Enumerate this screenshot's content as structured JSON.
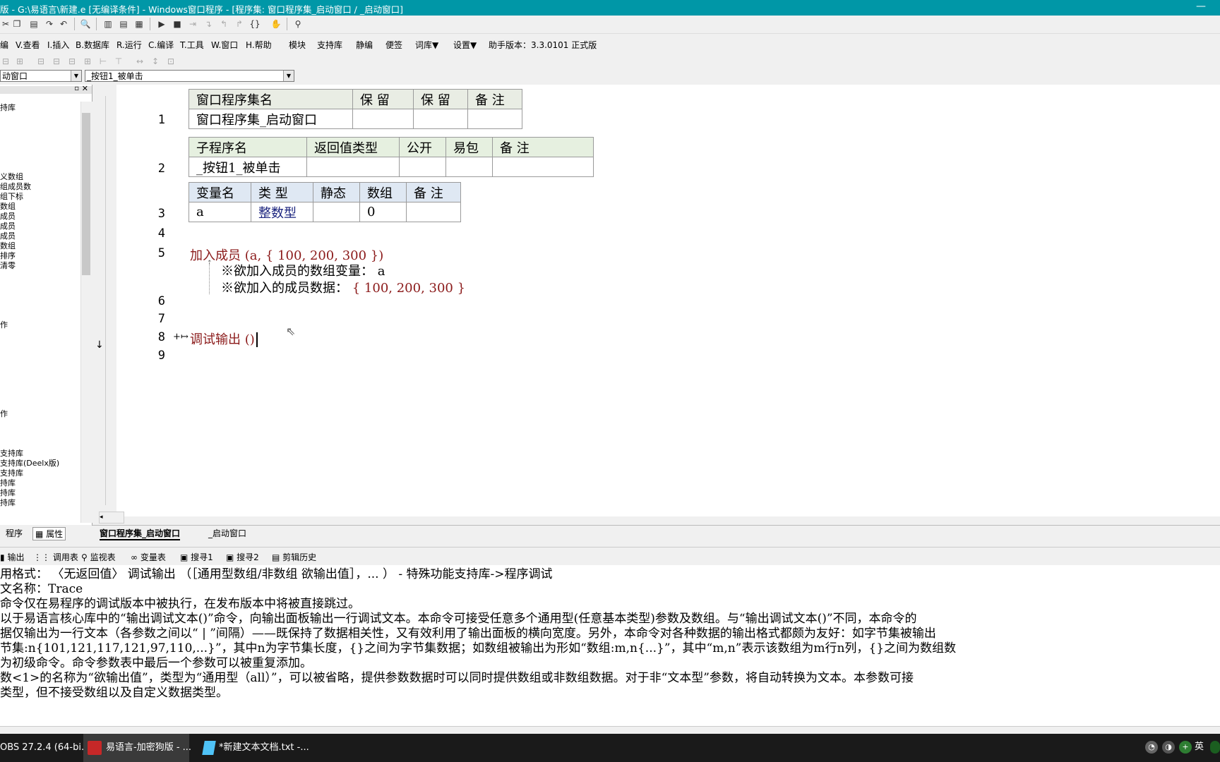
{
  "title": "版 - G:\\易语言\\新建.e [无编译条件] - Windows窗口程序 - [程序集: 窗口程序集_启动窗口 / _启动窗口]",
  "menu": [
    "编",
    "V.查看",
    "I.插入",
    "B.数据库",
    "R.运行",
    "C.编译",
    "T.工具",
    "W.窗口",
    "H.帮助",
    "模块",
    "支持库",
    "静编",
    "便签",
    "词库▼",
    "设置▼"
  ],
  "helper_version": "助手版本：3.3.0101 正式版",
  "combo_left": "动窗口",
  "combo_right": "_按钮1_被单击",
  "tree_items": [
    "持库",
    "义数组",
    "组成员数",
    "组下标",
    "数组",
    "成员",
    "成员",
    "成员",
    "数组",
    "排序",
    "清零",
    "作",
    "作",
    "支持库",
    "支持库(Deelx版)",
    "支持库",
    "持库",
    "持库",
    "持库"
  ],
  "editor": {
    "line_numbers": [
      "1",
      "2",
      "3",
      "4",
      "5",
      "6",
      "7",
      "8",
      "9"
    ],
    "t1": {
      "headers": [
        "窗口程序集名",
        "保 留",
        "保 留",
        "备 注"
      ],
      "row": [
        "窗口程序集_启动窗口",
        "",
        "",
        ""
      ]
    },
    "t2": {
      "headers": [
        "子程序名",
        "返回值类型",
        "公开",
        "易包",
        "备 注"
      ],
      "row": [
        "_按钮1_被单击",
        "",
        "",
        "",
        ""
      ]
    },
    "t3": {
      "headers": [
        "变量名",
        "类 型",
        "静态",
        "数组",
        "备 注"
      ],
      "row": [
        "a",
        "整数型",
        "",
        "0",
        ""
      ]
    },
    "line5_kw": "加入成员",
    "line5_args": " (a, { 100, 200, 300 })",
    "param1": "※欲加入成员的数组变量：  a",
    "param2_label": "※欲加入的成员数据：",
    "param2_val": "{ 100, 200, 300 }",
    "line8_marker": "+↦",
    "line8_kw": "调试输出",
    "line8_args": " ()"
  },
  "edit_tabs": [
    "窗口程序集_启动窗口",
    "_启动窗口"
  ],
  "left_tabs": [
    "程序",
    "属性"
  ],
  "panel_tabs": [
    "输出",
    "调用表",
    "监视表",
    "变量表",
    "搜寻1",
    "搜寻2",
    "剪辑历史"
  ],
  "output_lines": [
    "用格式：  〈无返回值〉 调试输出 （［通用型数组/非数组 欲输出值］，... ） - 特殊功能支持库->程序调试",
    "文名称：Trace",
    "命令仅在易程序的调试版本中被执行，在发布版本中将被直接跳过。",
    "以于易语言核心库中的“输出调试文本()”命令，向输出面板输出一行调试文本。本命令可接受任意多个通用型(任意基本类型)参数及数组。与“输出调试文本()”不同，本命令的",
    "据仅输出为一行文本（各参数之间以“ | ”间隔）——既保持了数据相关性，又有效利用了输出面板的横向宽度。另外，本命令对各种数据的输出格式都颇为友好：如字节集被输出",
    "节集:n{101,121,117,121,97,110,...}”，其中n为字节集长度，{}之间为字节集数据；如数组被输出为形如“数组:m,n{...}”，其中“m,n”表示该数组为m行n列，{}之间为数组数",
    "为初级命令。命令参数表中最后一个参数可以被重复添加。",
    "数<1>的名称为“欲输出值”，类型为“通用型（all）”，可以被省略，提供参数数据时可以同时提供数组或非数组数据。对于非“文本型”参数，将自动转换为文本。本参数可接",
    "类型，但不接受数组以及自定义数据类型。"
  ],
  "taskbar": {
    "items": [
      "OBS 27.2.4 (64-bi...",
      "易语言-加密狗版 - ...",
      "*新建文本文档.txt -..."
    ],
    "ime": "英"
  }
}
